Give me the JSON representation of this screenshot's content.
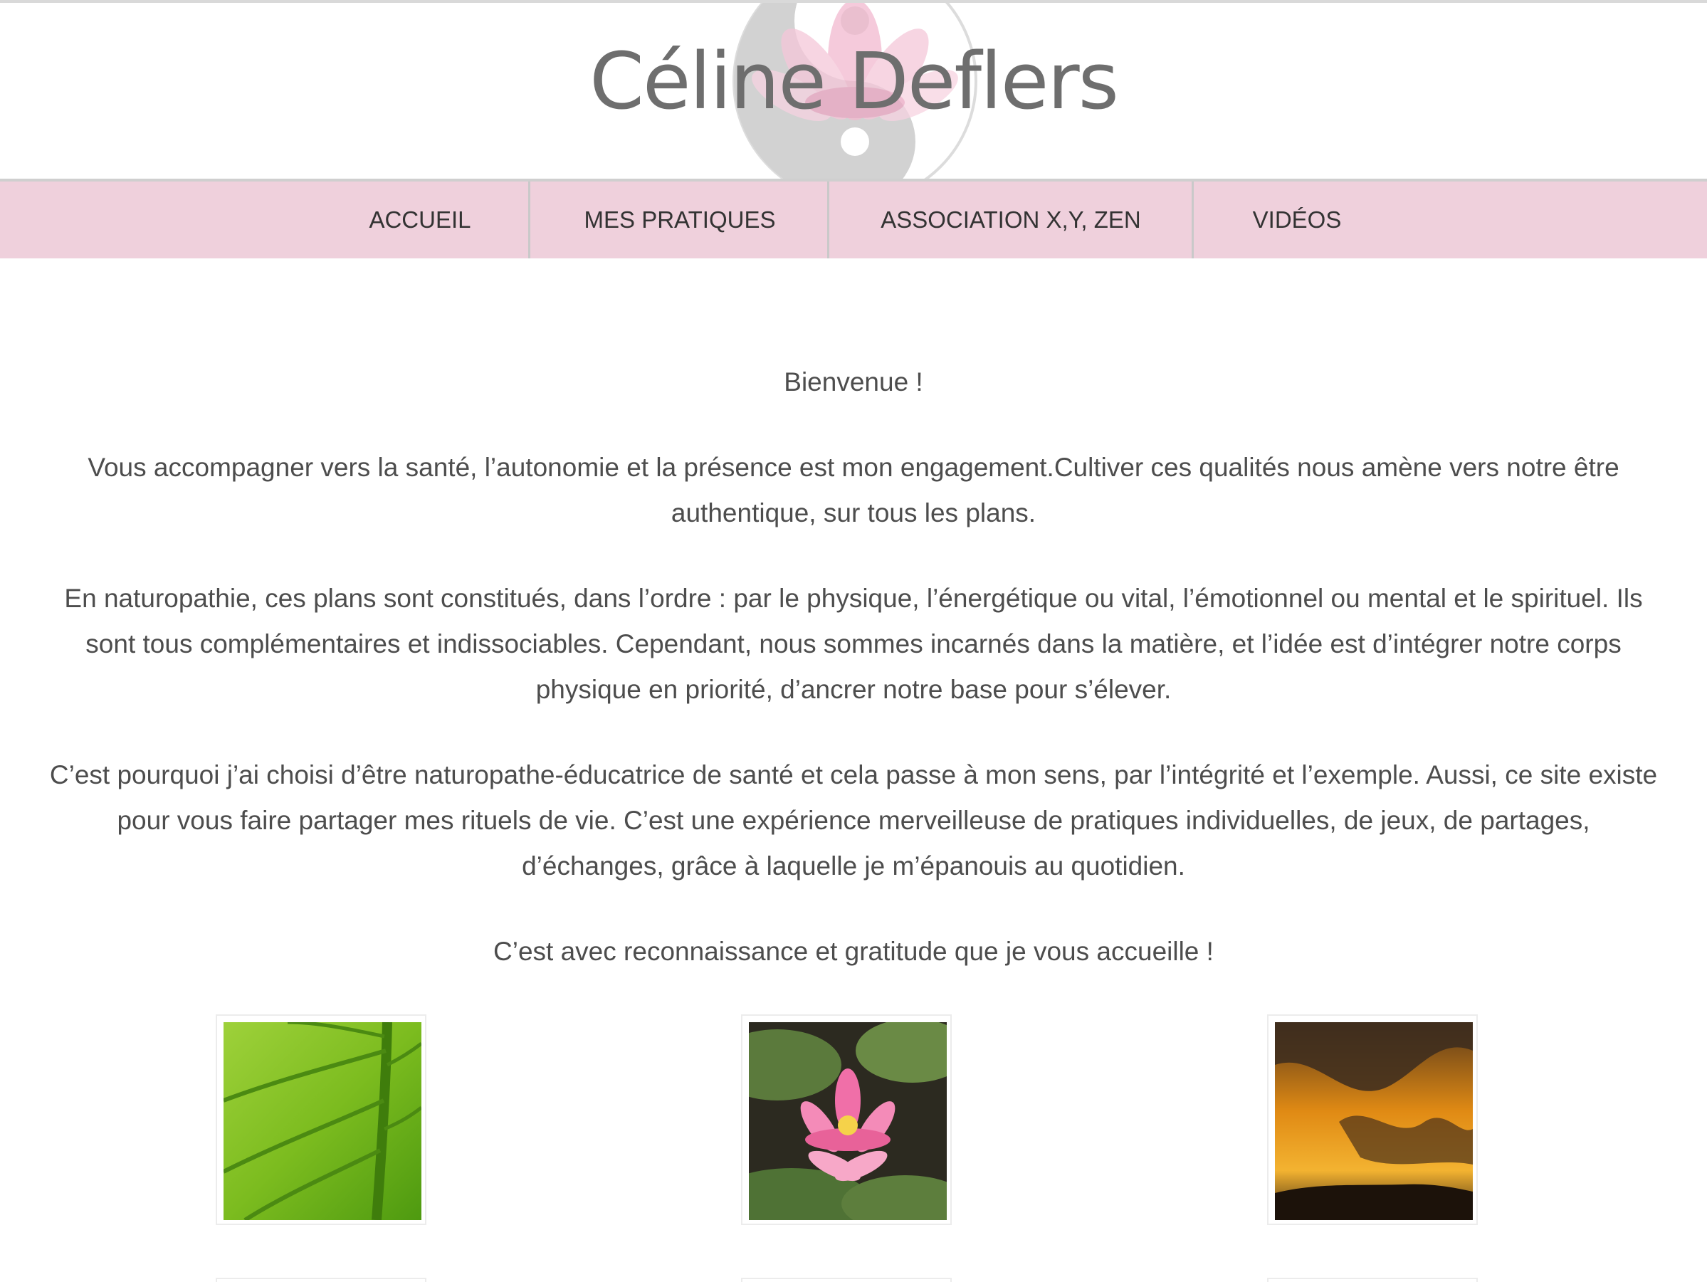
{
  "header": {
    "site_title": "Céline Deflers",
    "emblem_icon": "lotus-yin-yang-icon"
  },
  "nav": {
    "items": [
      {
        "label": "ACCUEIL"
      },
      {
        "label": "MES PRATIQUES"
      },
      {
        "label": "ASSOCIATION X,Y, ZEN"
      },
      {
        "label": "VIDÉOS"
      }
    ],
    "background_color": "#efd0dc"
  },
  "content": {
    "welcome": "Bienvenue !",
    "paragraphs": [
      "Vous accompagner vers la santé, l’autonomie et la présence est mon engagement.Cultiver ces qualités nous amène vers notre être authentique, sur tous les plans.",
      "En naturopathie, ces plans sont constitués, dans l’ordre : par le physique,  l’énergétique ou vital, l’émotionnel ou mental et le spirituel. Ils sont tous complémentaires et indissociables. Cependant, nous sommes incarnés dans la matière, et l’idée est d’intégrer notre corps physique en priorité, d’ancrer notre base pour s’élever.",
      "C’est pourquoi j’ai choisi d’être naturopathe-éducatrice de santé et cela passe à mon sens, par l’intégrité et l’exemple. Aussi, ce site existe pour vous faire partager mes rituels de vie. C’est une expérience merveilleuse de pratiques individuelles, de jeux, de partages, d’échanges, grâce à laquelle je m’épanouis au quotidien."
    ],
    "closing": "C’est avec reconnaissance et gratitude que je vous accueille !"
  },
  "gallery": {
    "images": [
      {
        "subject": "green-leaf-image"
      },
      {
        "subject": "pink-water-lily-image"
      },
      {
        "subject": "sunset-clouds-image"
      }
    ]
  }
}
